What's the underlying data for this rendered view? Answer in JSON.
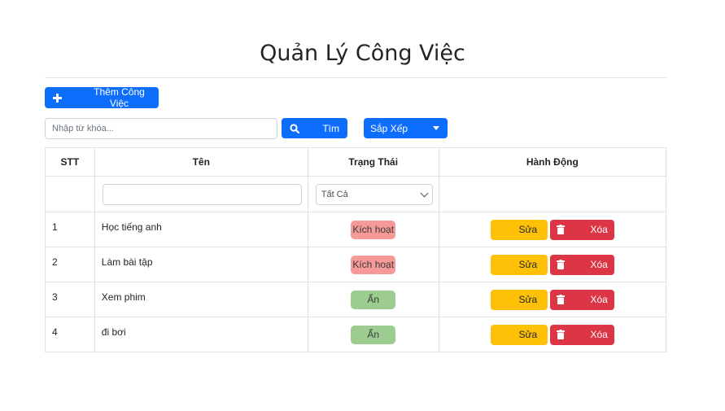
{
  "page": {
    "title": "Quản Lý Công Việc"
  },
  "toolbar": {
    "add_label": "Thêm Công Việc",
    "search_placeholder": "Nhập từ khóa...",
    "search_label": "Tìm",
    "sort_label": "Sắp Xếp"
  },
  "table": {
    "headers": {
      "stt": "STT",
      "name": "Tên",
      "status": "Trạng Thái",
      "actions": "Hành Động"
    },
    "filter": {
      "status_selected": "Tất Cả"
    },
    "rows": [
      {
        "stt": "1",
        "name": "Học tiếng anh",
        "status": "Kích hoạt",
        "edit": "Sửa",
        "delete": "Xóa"
      },
      {
        "stt": "2",
        "name": "Làm bài tập",
        "status": "Kích hoạt",
        "edit": "Sửa",
        "delete": "Xóa"
      },
      {
        "stt": "3",
        "name": "Xem phim",
        "status": "Ẩn",
        "edit": "Sửa",
        "delete": "Xóa"
      },
      {
        "stt": "4",
        "name": "đi bơi",
        "status": "Ẩn",
        "edit": "Sửa",
        "delete": "Xóa"
      }
    ]
  },
  "colors": {
    "primary": "#0d6efd",
    "warning": "#ffc107",
    "danger": "#dc3545",
    "badge_active": "#f59a98",
    "badge_hidden": "#9ccc8f"
  },
  "icons": {
    "add": "plus-icon",
    "search": "search-icon",
    "sort": "caret-down-icon",
    "delete": "trash-icon"
  }
}
